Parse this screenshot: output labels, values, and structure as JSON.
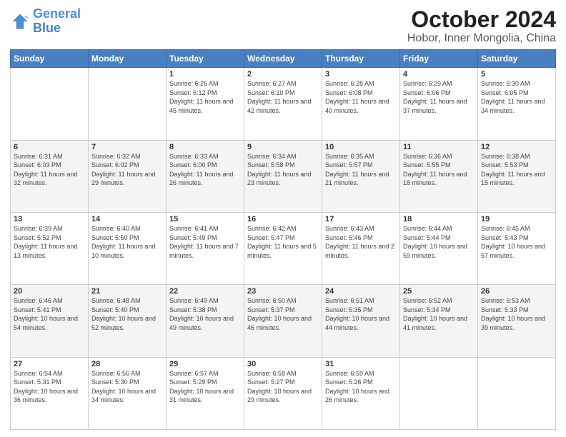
{
  "logo": {
    "line1": "General",
    "line2": "Blue"
  },
  "title": "October 2024",
  "subtitle": "Hobor, Inner Mongolia, China",
  "days_of_week": [
    "Sunday",
    "Monday",
    "Tuesday",
    "Wednesday",
    "Thursday",
    "Friday",
    "Saturday"
  ],
  "weeks": [
    [
      {
        "day": "",
        "sunrise": "",
        "sunset": "",
        "daylight": ""
      },
      {
        "day": "",
        "sunrise": "",
        "sunset": "",
        "daylight": ""
      },
      {
        "day": "1",
        "sunrise": "Sunrise: 6:26 AM",
        "sunset": "Sunset: 6:12 PM",
        "daylight": "Daylight: 11 hours and 45 minutes."
      },
      {
        "day": "2",
        "sunrise": "Sunrise: 6:27 AM",
        "sunset": "Sunset: 6:10 PM",
        "daylight": "Daylight: 11 hours and 42 minutes."
      },
      {
        "day": "3",
        "sunrise": "Sunrise: 6:28 AM",
        "sunset": "Sunset: 6:08 PM",
        "daylight": "Daylight: 11 hours and 40 minutes."
      },
      {
        "day": "4",
        "sunrise": "Sunrise: 6:29 AM",
        "sunset": "Sunset: 6:06 PM",
        "daylight": "Daylight: 11 hours and 37 minutes."
      },
      {
        "day": "5",
        "sunrise": "Sunrise: 6:30 AM",
        "sunset": "Sunset: 6:05 PM",
        "daylight": "Daylight: 11 hours and 34 minutes."
      }
    ],
    [
      {
        "day": "6",
        "sunrise": "Sunrise: 6:31 AM",
        "sunset": "Sunset: 6:03 PM",
        "daylight": "Daylight: 11 hours and 32 minutes."
      },
      {
        "day": "7",
        "sunrise": "Sunrise: 6:32 AM",
        "sunset": "Sunset: 6:02 PM",
        "daylight": "Daylight: 11 hours and 29 minutes."
      },
      {
        "day": "8",
        "sunrise": "Sunrise: 6:33 AM",
        "sunset": "Sunset: 6:00 PM",
        "daylight": "Daylight: 11 hours and 26 minutes."
      },
      {
        "day": "9",
        "sunrise": "Sunrise: 6:34 AM",
        "sunset": "Sunset: 5:58 PM",
        "daylight": "Daylight: 11 hours and 23 minutes."
      },
      {
        "day": "10",
        "sunrise": "Sunrise: 6:35 AM",
        "sunset": "Sunset: 5:57 PM",
        "daylight": "Daylight: 11 hours and 21 minutes."
      },
      {
        "day": "11",
        "sunrise": "Sunrise: 6:36 AM",
        "sunset": "Sunset: 5:55 PM",
        "daylight": "Daylight: 11 hours and 18 minutes."
      },
      {
        "day": "12",
        "sunrise": "Sunrise: 6:38 AM",
        "sunset": "Sunset: 5:53 PM",
        "daylight": "Daylight: 11 hours and 15 minutes."
      }
    ],
    [
      {
        "day": "13",
        "sunrise": "Sunrise: 6:39 AM",
        "sunset": "Sunset: 5:52 PM",
        "daylight": "Daylight: 11 hours and 13 minutes."
      },
      {
        "day": "14",
        "sunrise": "Sunrise: 6:40 AM",
        "sunset": "Sunset: 5:50 PM",
        "daylight": "Daylight: 11 hours and 10 minutes."
      },
      {
        "day": "15",
        "sunrise": "Sunrise: 6:41 AM",
        "sunset": "Sunset: 5:49 PM",
        "daylight": "Daylight: 11 hours and 7 minutes."
      },
      {
        "day": "16",
        "sunrise": "Sunrise: 6:42 AM",
        "sunset": "Sunset: 5:47 PM",
        "daylight": "Daylight: 11 hours and 5 minutes."
      },
      {
        "day": "17",
        "sunrise": "Sunrise: 6:43 AM",
        "sunset": "Sunset: 5:46 PM",
        "daylight": "Daylight: 11 hours and 2 minutes."
      },
      {
        "day": "18",
        "sunrise": "Sunrise: 6:44 AM",
        "sunset": "Sunset: 5:44 PM",
        "daylight": "Daylight: 10 hours and 59 minutes."
      },
      {
        "day": "19",
        "sunrise": "Sunrise: 6:45 AM",
        "sunset": "Sunset: 5:43 PM",
        "daylight": "Daylight: 10 hours and 57 minutes."
      }
    ],
    [
      {
        "day": "20",
        "sunrise": "Sunrise: 6:46 AM",
        "sunset": "Sunset: 5:41 PM",
        "daylight": "Daylight: 10 hours and 54 minutes."
      },
      {
        "day": "21",
        "sunrise": "Sunrise: 6:48 AM",
        "sunset": "Sunset: 5:40 PM",
        "daylight": "Daylight: 10 hours and 52 minutes."
      },
      {
        "day": "22",
        "sunrise": "Sunrise: 6:49 AM",
        "sunset": "Sunset: 5:38 PM",
        "daylight": "Daylight: 10 hours and 49 minutes."
      },
      {
        "day": "23",
        "sunrise": "Sunrise: 6:50 AM",
        "sunset": "Sunset: 5:37 PM",
        "daylight": "Daylight: 10 hours and 46 minutes."
      },
      {
        "day": "24",
        "sunrise": "Sunrise: 6:51 AM",
        "sunset": "Sunset: 5:35 PM",
        "daylight": "Daylight: 10 hours and 44 minutes."
      },
      {
        "day": "25",
        "sunrise": "Sunrise: 6:52 AM",
        "sunset": "Sunset: 5:34 PM",
        "daylight": "Daylight: 10 hours and 41 minutes."
      },
      {
        "day": "26",
        "sunrise": "Sunrise: 6:53 AM",
        "sunset": "Sunset: 5:33 PM",
        "daylight": "Daylight: 10 hours and 39 minutes."
      }
    ],
    [
      {
        "day": "27",
        "sunrise": "Sunrise: 6:54 AM",
        "sunset": "Sunset: 5:31 PM",
        "daylight": "Daylight: 10 hours and 36 minutes."
      },
      {
        "day": "28",
        "sunrise": "Sunrise: 6:56 AM",
        "sunset": "Sunset: 5:30 PM",
        "daylight": "Daylight: 10 hours and 34 minutes."
      },
      {
        "day": "29",
        "sunrise": "Sunrise: 6:57 AM",
        "sunset": "Sunset: 5:29 PM",
        "daylight": "Daylight: 10 hours and 31 minutes."
      },
      {
        "day": "30",
        "sunrise": "Sunrise: 6:58 AM",
        "sunset": "Sunset: 5:27 PM",
        "daylight": "Daylight: 10 hours and 29 minutes."
      },
      {
        "day": "31",
        "sunrise": "Sunrise: 6:59 AM",
        "sunset": "Sunset: 5:26 PM",
        "daylight": "Daylight: 10 hours and 26 minutes."
      },
      {
        "day": "",
        "sunrise": "",
        "sunset": "",
        "daylight": ""
      },
      {
        "day": "",
        "sunrise": "",
        "sunset": "",
        "daylight": ""
      }
    ]
  ]
}
